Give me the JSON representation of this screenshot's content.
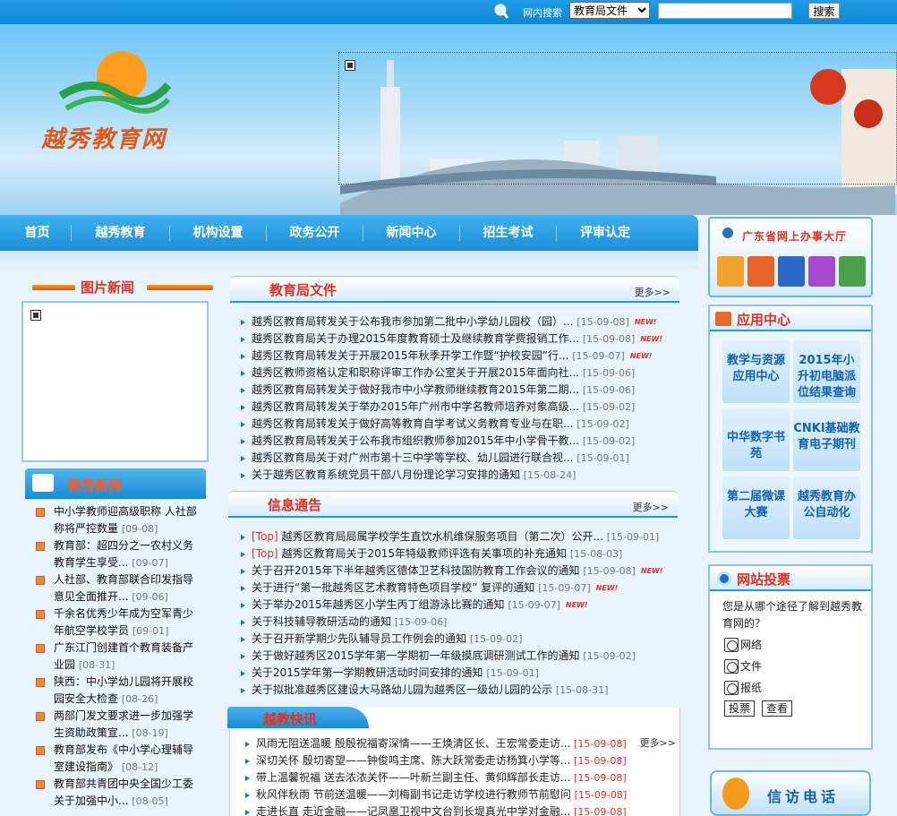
{
  "topbar": {
    "search_label": "网内搜索",
    "select_value": "教育局文件",
    "search_button": "搜索"
  },
  "banner": {
    "logo_text": "越秀教育网"
  },
  "nav": {
    "items": [
      "首页",
      "越秀教育",
      "机构设置",
      "政务公开",
      "新闻中心",
      "招生考试",
      "评审认定"
    ]
  },
  "pic_news": {
    "title": "图片新闻"
  },
  "edu_news": {
    "title": "教育新闻",
    "items": [
      {
        "text": "中小学教师迎高级职称 人社部称将严控数量",
        "date": "[09-08]"
      },
      {
        "text": "教育部：超四分之一农村义务教育学生享受...",
        "date": "[09-07]"
      },
      {
        "text": "人社部、教育部联合印发指导意见全面推开...",
        "date": "[09-06]"
      },
      {
        "text": "千余名优秀少年成为空军青少年航空学校学员",
        "date": "[09-01]"
      },
      {
        "text": "广东江门创建首个教育装备产业园",
        "date": "[08-31]"
      },
      {
        "text": "陕西：中小学幼儿园将开展校园安全大检查",
        "date": "[08-26]"
      },
      {
        "text": "两部门发文要求进一步加强学生资助政策宣...",
        "date": "[08-19]"
      },
      {
        "text": "教育部发布《中小学心理辅导室建设指南》",
        "date": "[08-12]"
      },
      {
        "text": "教育部共青团中央全国少工委关于加强中小...",
        "date": "[08-05]"
      }
    ]
  },
  "docs": {
    "title": "教育局文件",
    "more": "更多>>",
    "items": [
      {
        "text": "越秀区教育局转发关于公布我市参加第二批中小学幼儿园校（园）...",
        "date": "[15-09-08]",
        "new": "NEW!"
      },
      {
        "text": "越秀区教育局关于办理2015年度教育硕士及继续教育学费报销工作...",
        "date": "[15-09-08]",
        "new": "NEW!"
      },
      {
        "text": "越秀区教育局转发关于开展2015年秋季开学工作暨“护校安园”行...",
        "date": "[15-09-07]",
        "new": "NEW!"
      },
      {
        "text": "越秀区教师资格认定和职称评审工作办公室关于开展2015年面向社...",
        "date": "[15-09-06]",
        "new": ""
      },
      {
        "text": "越秀区教育局转发关于做好我市中小学教师继续教育2015年第二期...",
        "date": "[15-09-06]",
        "new": ""
      },
      {
        "text": "越秀区教育局转发关于举办2015年广州市中学名教师培养对象高级...",
        "date": "[15-09-02]",
        "new": ""
      },
      {
        "text": "越秀区教育局转发关于做好高等教育自学考试义务教育专业与在职...",
        "date": "[15-09-02]",
        "new": ""
      },
      {
        "text": "越秀区教育局转发关于公布我市组织教师参加2015年中小学骨干教...",
        "date": "[15-09-02]",
        "new": ""
      },
      {
        "text": "越秀区教育局关于对广州市第十三中学等学校、幼儿园进行联合视...",
        "date": "[15-09-01]",
        "new": ""
      },
      {
        "text": "关于越秀区教育系统党员干部八月份理论学习安排的通知",
        "date": "[15-08-24]",
        "new": ""
      }
    ]
  },
  "notices": {
    "title": "信息通告",
    "more": "更多>>",
    "items": [
      {
        "tag": "[Top]",
        "text": "越秀区教育局局属学校学生直饮水机维保服务项目（第二次）公开...",
        "date": "[15-09-01]",
        "new": ""
      },
      {
        "tag": "[Top]",
        "text": "越秀区教育局关于2015年特级教师评选有关事项的补充通知",
        "date": "[15-08-03]",
        "new": ""
      },
      {
        "tag": "",
        "text": "关于召开2015年下半年越秀区德体卫艺科技国防教育工作会议的通知",
        "date": "[15-09-08]",
        "new": "NEW!"
      },
      {
        "tag": "",
        "text": "关于进行“第一批越秀区艺术教育特色项目学校” 复评的通知",
        "date": "[15-09-07]",
        "new": "NEW!"
      },
      {
        "tag": "",
        "text": "关于举办2015年越秀区小学生丙丁组游泳比赛的通知",
        "date": "[15-09-07]",
        "new": "NEW!"
      },
      {
        "tag": "",
        "text": "关于科技辅导教研活动的通知",
        "date": "[15-09-06]",
        "new": ""
      },
      {
        "tag": "",
        "text": "关于召开新学期少先队辅导员工作例会的通知",
        "date": "[15-09-02]",
        "new": ""
      },
      {
        "tag": "",
        "text": "关于做好越秀区2015学年第一学期初一年级摸底调研测试工作的通知",
        "date": "[15-09-02]",
        "new": ""
      },
      {
        "tag": "",
        "text": "关于2015学年第一学期教研活动时间安排的通知",
        "date": "[15-09-01]",
        "new": ""
      },
      {
        "tag": "",
        "text": "关于拟批准越秀区建设大马路幼儿园为越秀区一级幼儿园的公示",
        "date": "[15-08-31]",
        "new": ""
      }
    ]
  },
  "quick": {
    "title": "越教快讯",
    "more": "更多>>",
    "items": [
      {
        "text": "风雨无阻送温暖 殷殷祝福寄深情——王焕清区长、王宏常委走访...",
        "date": "[15-09-08]"
      },
      {
        "text": "深切关怀 殷切寄望——钟俊鸣主席、陈大跃常委走访杨箕小学等...",
        "date": "[15-09-08]"
      },
      {
        "text": "带上温馨祝福 送去浓浓关怀——叶新兰副主任、黄仰辉部长走访...",
        "date": "[15-09-08]"
      },
      {
        "text": "秋风伴秋雨 节前送温暖——刘梅副书记走访学校进行教师节前慰问",
        "date": "[15-09-08]"
      },
      {
        "text": "走进长直 走近金融——记凤凰卫视中文台到长堤真光中学对金融...",
        "date": "[15-09-08]"
      }
    ]
  },
  "gov": {
    "title": "广东省网上办事大厅"
  },
  "apps": {
    "title": "应用中心",
    "tiles": [
      "教学与资源应用中心",
      "2015年小升初电脑派位结果查询",
      "中华数字书苑",
      "CNKI基础教育电子期刊",
      "第二届微课大赛",
      "越秀教育办公自动化"
    ]
  },
  "vote": {
    "title": "网站投票",
    "question": "您是从哪个途径了解到越秀教育网的？",
    "options": [
      "网络",
      "文件",
      "报纸"
    ],
    "vote_button": "投票",
    "view_button": "查看"
  },
  "petition": {
    "title": "信访电话"
  }
}
